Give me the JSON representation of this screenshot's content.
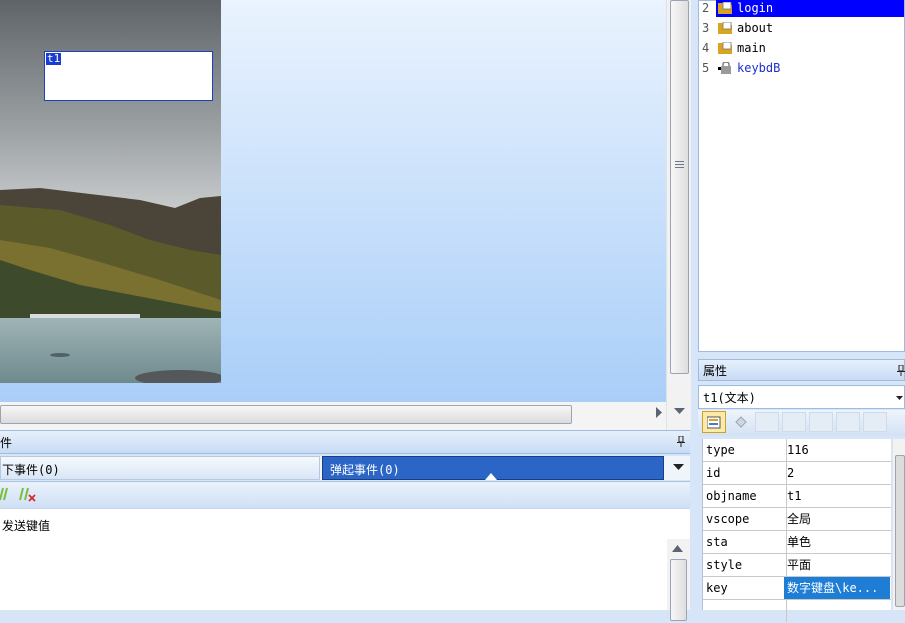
{
  "canvas": {
    "textbox_label": "t1"
  },
  "events_panel": {
    "title_fragment": "件",
    "tab_down_label": "下事件(0)",
    "tab_up_label": "弹起事件(0)",
    "row_text": "发送键值"
  },
  "page_tree": {
    "items": [
      {
        "num": "2",
        "label": "login",
        "icon": "folder-page-icon",
        "selected": true
      },
      {
        "num": "3",
        "label": "about",
        "icon": "folder-page-icon",
        "selected": false
      },
      {
        "num": "4",
        "label": "main",
        "icon": "folder-page-icon",
        "selected": false
      },
      {
        "num": "5",
        "label": "keybdB",
        "icon": "lock-page-icon",
        "selected": false
      }
    ]
  },
  "properties": {
    "title": "属性",
    "pin_glyph": "ᵖ",
    "selected_object": "t1(文本)",
    "rows": [
      {
        "key": "type",
        "value": "116"
      },
      {
        "key": "id",
        "value": "2"
      },
      {
        "key": "objname",
        "value": "t1"
      },
      {
        "key": "vscope",
        "value": "全局"
      },
      {
        "key": "sta",
        "value": "单色"
      },
      {
        "key": "style",
        "value": "平面"
      },
      {
        "key": "key",
        "value": "数字键盘\\ke..."
      }
    ]
  },
  "colors": {
    "selection_blue": "#0000ff",
    "tab_active": "#2b65c6"
  }
}
